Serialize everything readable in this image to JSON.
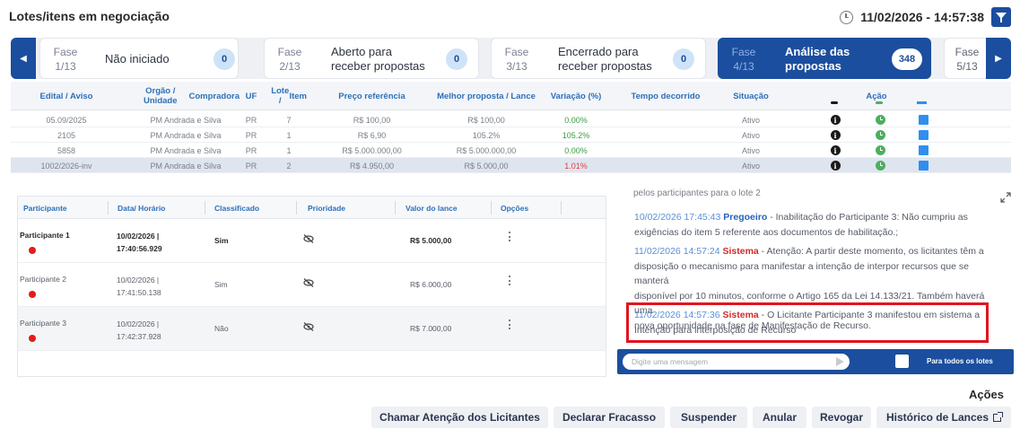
{
  "header": {
    "title": "Lotes/itens em negociação",
    "datetime": "11/02/2026 - 14:57:38"
  },
  "phases": [
    {
      "num": "Fase\n1/13",
      "num_a": "Fase",
      "num_b": "1/13",
      "label_a": "Não iniciado",
      "label_b": "",
      "count": "0",
      "active": false
    },
    {
      "num_a": "Fase",
      "num_b": "2/13",
      "label_a": "Aberto para",
      "label_b": "receber propostas",
      "count": "0",
      "active": false
    },
    {
      "num_a": "Fase",
      "num_b": "3/13",
      "label_a": "Encerrado para",
      "label_b": "receber propostas",
      "count": "0",
      "active": false
    },
    {
      "num_a": "Fase",
      "num_b": "4/13",
      "label_a": "Análise das",
      "label_b": "propostas",
      "count": "348",
      "active": true
    },
    {
      "num_a": "Fase",
      "num_b": "5/13"
    }
  ],
  "lots": {
    "columns": [
      "Edital / Aviso",
      "Orgão / Unidade Compradora",
      "UF",
      "Lote / Item",
      "Preço referência",
      "Melhor proposta / Lance",
      "Variação (%)",
      "Tempo decorrido",
      "Situação",
      "Ação"
    ],
    "col_a": "Orgão / Unidade",
    "col_b": "Compradora",
    "lote_a": "Lote /",
    "lote_b": "Item",
    "rows": [
      {
        "edital": "05.09/2025",
        "orgao": "PM Andrada e Silva",
        "uf": "PR",
        "lote": "7",
        "preco": "R$ 100,00",
        "melhor": "R$ 100,00",
        "variacao": "0.00%",
        "var_color": "green",
        "tempo": "",
        "situacao": "Ativo"
      },
      {
        "edital": "2105",
        "orgao": "PM Andrada e Silva",
        "uf": "PR",
        "lote": "1",
        "preco": "R$ 6,90",
        "melhor": "105.2%",
        "variacao": "105.2%",
        "var_color": "green",
        "tempo": "",
        "situacao": "Ativo"
      },
      {
        "edital": "5858",
        "orgao": "PM Andrada e Silva",
        "uf": "PR",
        "lote": "1",
        "preco": "R$ 5.000.000,00",
        "melhor": "R$ 5.000.000,00",
        "variacao": "0.00%",
        "var_color": "green",
        "tempo": "",
        "situacao": "Ativo"
      },
      {
        "edital": "1002/2026-inv",
        "orgao": "PM Andrada e Silva",
        "uf": "PR",
        "lote": "2",
        "preco": "R$ 4.950,00",
        "melhor": "R$ 5.000,00",
        "variacao": "1.01%",
        "var_color": "red",
        "tempo": "",
        "situacao": "Ativo"
      }
    ]
  },
  "participants": {
    "columns": [
      "Participante",
      "Data/ Horário",
      "Classificado",
      "Prioridade",
      "Valor do lance",
      "Opções"
    ],
    "rows": [
      {
        "name": "Participante 1",
        "date": "10/02/2026 |",
        "time": "17:40:56.929",
        "classificado": "Sim",
        "valor": "R$ 5.000,00"
      },
      {
        "name": "Participante 2",
        "date": "10/02/2026 |",
        "time": "17:41:50.138",
        "classificado": "Sim",
        "valor": "R$ 6.000,00"
      },
      {
        "name": "Participante 3",
        "date": "10/02/2026 |",
        "time": "17:42:37.928",
        "classificado": "Não",
        "valor": "R$ 7.000,00"
      }
    ]
  },
  "chat": {
    "top_fragment": "pelos participantes para o lote 2",
    "messages": [
      {
        "time": "10/02/2026 17:45:43",
        "who": "Pregoeiro",
        "line1": " - Inabilitação do Participante 3: Não cumpriu as",
        "line2": "exigências do item 5 referente aos documentos de habilitação.;"
      },
      {
        "time": "11/02/2026 14:57:24",
        "who": "Sistema",
        "line1": " - Atenção: A partir deste momento, os licitantes têm a",
        "line2": "disposição o mecanismo para manifestar a intenção de interpor recursos que se manterá",
        "line3": "disponível por 10 minutos, conforme o Artigo 165 da Lei 14.133/21. Também haverá uma",
        "line4": "nova oportunidade na fase de Manifestação de Recurso."
      },
      {
        "time": "11/02/2026 14:57:36",
        "who": "Sistema",
        "line1": " - O Licitante Participante 3 manifestou em sistema a",
        "line2": "Intenção para interposição de Recurso"
      }
    ],
    "input_placeholder": "Digite uma mensagem",
    "all_lots_label": "Para todos os lotes"
  },
  "actions": {
    "title": "Ações",
    "buttons": [
      "Chamar Atenção dos Licitantes",
      "Declarar Fracasso",
      "Suspender",
      "Anular",
      "Revogar",
      "Histórico de Lances"
    ]
  },
  "icons": {
    "clock": "clock-icon",
    "filter": "filter-icon",
    "info": "info-icon",
    "timer": "timer-icon",
    "detail": "square-icon",
    "priority": "eye-slash-icon",
    "options": "kebab-icon",
    "send": "send-icon",
    "external": "external-link-icon"
  },
  "colors": {
    "brand": "#1b4e9e",
    "highlight": "#e1141d",
    "positive": "#3aa040",
    "negative": "#e03d3d"
  }
}
